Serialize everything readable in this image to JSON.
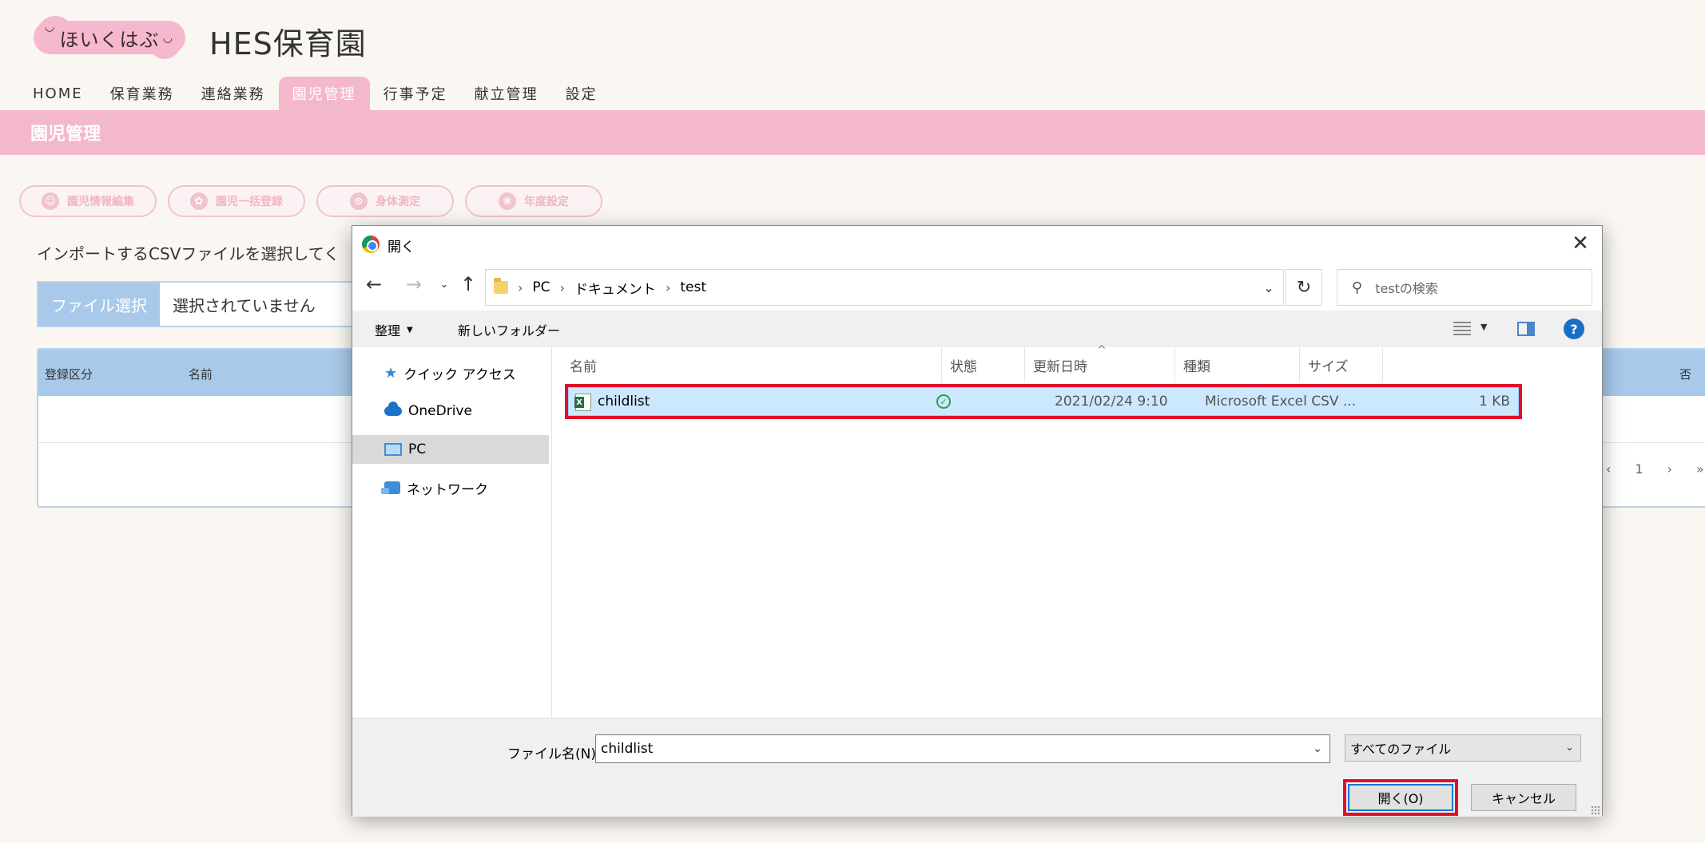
{
  "app": {
    "logo_text": "ほいくはぶ",
    "title": "HES保育園",
    "nav": [
      {
        "label": "HOME"
      },
      {
        "label": "保育業務"
      },
      {
        "label": "連絡業務"
      },
      {
        "label": "園児管理"
      },
      {
        "label": "行事予定"
      },
      {
        "label": "献立管理"
      },
      {
        "label": "設定"
      }
    ],
    "active_nav": "園児管理",
    "section_title": "園児管理",
    "sub_buttons": [
      {
        "label": "園児情報編集"
      },
      {
        "label": "園児一括登録"
      },
      {
        "label": "身体測定"
      },
      {
        "label": "年度設定"
      }
    ],
    "instruction": "インポートするCSVファイルを選択してく",
    "file_select_label": "ファイル選択",
    "file_none_text": "選択されていません",
    "table_headers": [
      "登録区分",
      "名前"
    ],
    "table_header_right_fragment": "否",
    "pager": {
      "prev": "‹",
      "page": "1",
      "next": "›",
      "last": "»"
    }
  },
  "dialog": {
    "title": "開く",
    "breadcrumb": [
      "PC",
      "ドキュメント",
      "test"
    ],
    "search_placeholder": "testの検索",
    "toolbar": {
      "organize": "整理",
      "new_folder": "新しいフォルダー"
    },
    "nav_pane": [
      {
        "label": "クイック アクセス"
      },
      {
        "label": "OneDrive"
      },
      {
        "label": "PC"
      },
      {
        "label": "ネットワーク"
      }
    ],
    "selected_nav": "PC",
    "columns": [
      "名前",
      "状態",
      "更新日時",
      "種類",
      "サイズ"
    ],
    "files": [
      {
        "name": "childlist",
        "status": "synced",
        "modified": "2021/02/24 9:10",
        "type": "Microsoft Excel CSV ...",
        "size": "1 KB"
      }
    ],
    "filename_label": "ファイル名(N):",
    "filename_value": "childlist",
    "filetype_value": "すべてのファイル",
    "open_button": "開く(O)",
    "cancel_button": "キャンセル"
  },
  "colors": {
    "brand_pink": "#f4b8cc",
    "table_blue": "#a8c9ea",
    "highlight_red": "#e0102b",
    "selection_blue": "#cce8ff"
  }
}
